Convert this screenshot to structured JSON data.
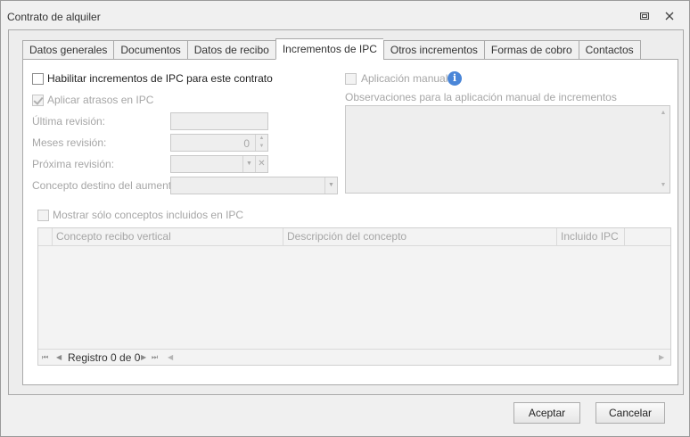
{
  "window": {
    "title": "Contrato de alquiler"
  },
  "tabs": [
    {
      "label": "Datos generales",
      "active": false
    },
    {
      "label": "Documentos",
      "active": false
    },
    {
      "label": "Datos de recibo",
      "active": false
    },
    {
      "label": "Incrementos de IPC",
      "active": true
    },
    {
      "label": "Otros incrementos",
      "active": false
    },
    {
      "label": "Formas de cobro",
      "active": false
    },
    {
      "label": "Contactos",
      "active": false
    }
  ],
  "ipc": {
    "enable_label": "Habilitar incrementos de IPC para este contrato",
    "enable_checked": false,
    "arrears_label": "Aplicar atrasos en IPC",
    "arrears_checked": true,
    "last_review_label": "Última revisión:",
    "last_review_value": "",
    "months_review_label": "Meses revisión:",
    "months_review_value": "0",
    "next_review_label": "Próxima revisión:",
    "next_review_value": "",
    "target_concept_label": "Concepto destino del aumento:",
    "target_concept_value": "",
    "manual_label": "Aplicación manual",
    "manual_checked": false,
    "observations_label": "Observaciones para la aplicación manual de incrementos",
    "observations_value": "",
    "only_ipc_label": "Mostrar sólo conceptos incluidos en IPC",
    "only_ipc_checked": false
  },
  "grid": {
    "columns": [
      "Concepto recibo vertical",
      "Descripción del concepto",
      "Incluido IPC"
    ],
    "rows": [],
    "navigator_text": "Registro 0 de 0"
  },
  "buttons": {
    "ok_label": "Aceptar",
    "cancel_label": "Cancelar"
  },
  "colors": {
    "info_icon": "#4a86d8",
    "disabled_text": "#a6a6a6"
  }
}
